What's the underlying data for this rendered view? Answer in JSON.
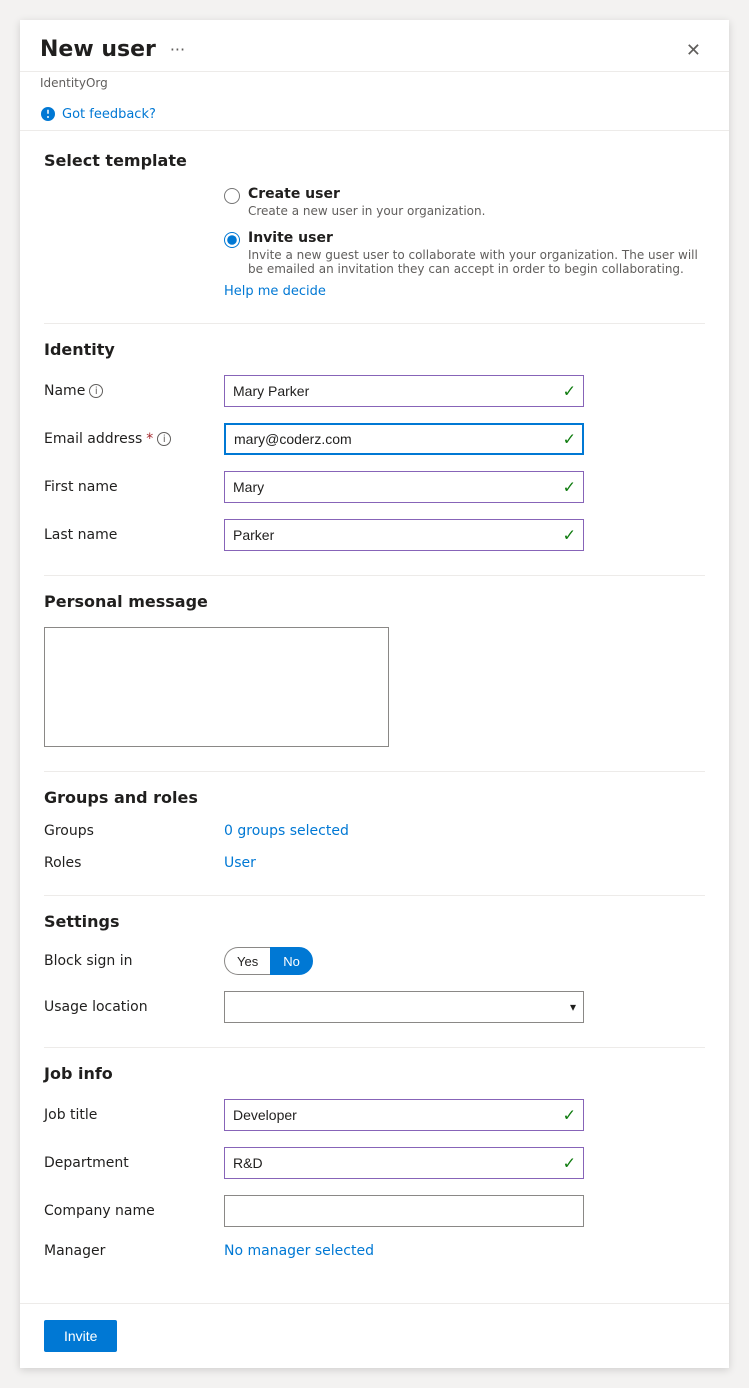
{
  "panel": {
    "title": "New user",
    "org": "IdentityOrg",
    "close_label": "✕",
    "more_label": "···"
  },
  "feedback": {
    "label": "Got feedback?"
  },
  "template_section": {
    "title": "Select template",
    "create_user": {
      "label": "Create user",
      "desc": "Create a new user in your organization."
    },
    "invite_user": {
      "label": "Invite user",
      "desc": "Invite a new guest user to collaborate with your organization. The user will be emailed an invitation they can accept in order to begin collaborating."
    },
    "help_link": "Help me decide"
  },
  "identity_section": {
    "title": "Identity",
    "name_label": "Name",
    "name_value": "Mary Parker",
    "email_label": "Email address",
    "email_required": "*",
    "email_value": "mary@coderz.com",
    "firstname_label": "First name",
    "firstname_value": "Mary",
    "lastname_label": "Last name",
    "lastname_value": "Parker"
  },
  "personal_message_section": {
    "title": "Personal message",
    "placeholder": ""
  },
  "groups_roles_section": {
    "title": "Groups and roles",
    "groups_label": "Groups",
    "groups_value": "0 groups selected",
    "roles_label": "Roles",
    "roles_value": "User"
  },
  "settings_section": {
    "title": "Settings",
    "block_signin_label": "Block sign in",
    "yes_label": "Yes",
    "no_label": "No",
    "usage_location_label": "Usage location",
    "usage_location_placeholder": ""
  },
  "job_info_section": {
    "title": "Job info",
    "job_title_label": "Job title",
    "job_title_value": "Developer",
    "department_label": "Department",
    "department_value": "R&D",
    "company_label": "Company name",
    "company_value": "",
    "manager_label": "Manager",
    "manager_value": "No manager selected"
  },
  "footer": {
    "invite_label": "Invite"
  }
}
